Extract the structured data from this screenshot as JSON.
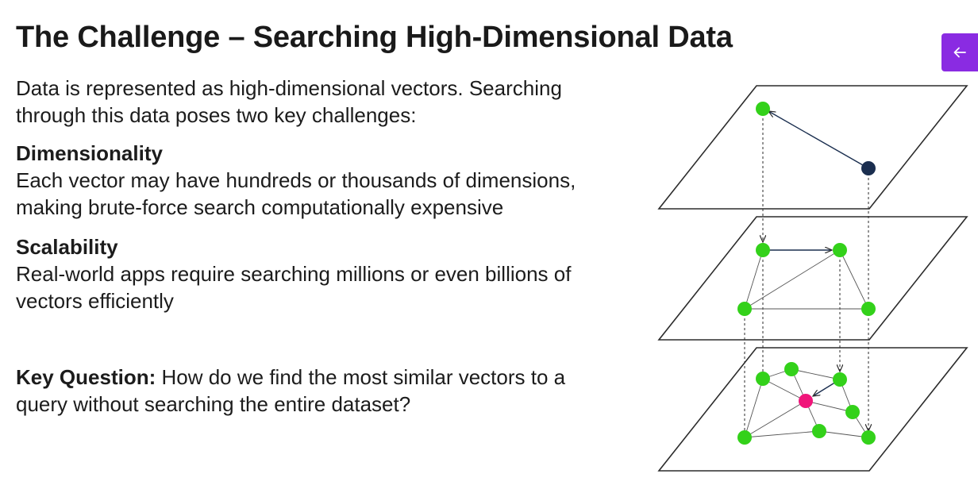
{
  "slide": {
    "title": "The Challenge – Searching High-Dimensional Data",
    "intro_line1": "Data is represented as high-dimensional vectors. Searching",
    "intro_line2": "through this data poses two key challenges:",
    "dimensionality_heading": "Dimensionality",
    "dimensionality_line1": "Each vector may have hundreds or thousands of dimensions,",
    "dimensionality_line2": "making brute-force search computationally expensive",
    "scalability_heading": "Scalability",
    "scalability_line1": "Real-world apps require searching millions or even billions of",
    "scalability_line2": "vectors efficiently",
    "key_question_label": "Key Question:",
    "key_question_line1_rest": " How do we find the most similar vectors to a",
    "key_question_line2": "query without searching the entire dataset?"
  },
  "navigation": {
    "back_icon": "arrow-left-icon",
    "accent_color": "#8a2be2"
  },
  "diagram": {
    "node_color": "#33d11a",
    "entry_node_color": "#1a2e4f",
    "query_node_color": "#f0157a",
    "line_color": "#2b2b2b",
    "layers": 3
  }
}
